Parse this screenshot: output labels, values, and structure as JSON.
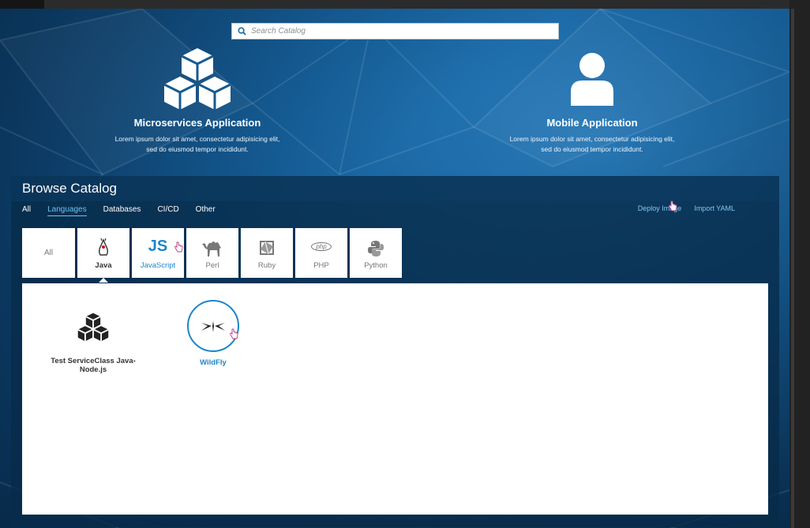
{
  "search": {
    "placeholder": "Search Catalog"
  },
  "featured": [
    {
      "title": "Microservices Application",
      "desc_line1": "Lorem ipsum dolor sit amet, consectetur adipisicing elit,",
      "desc_line2": "sed do eiusmod tempor incididunt.",
      "icon": "cubes-icon"
    },
    {
      "title": "Mobile Application",
      "desc_line1": "Lorem ipsum dolor sit amet, consectetur adipisicing elit,",
      "desc_line2": "sed do eiusmod tempor incididunt.",
      "icon": "user-icon"
    }
  ],
  "browse": {
    "title": "Browse Catalog",
    "tabs": [
      "All",
      "Languages",
      "Databases",
      "CI/CD",
      "Other"
    ],
    "active_tab": "Languages",
    "actions": [
      "Deploy Image",
      "Import YAML"
    ]
  },
  "languages": [
    {
      "label": "All",
      "icon": ""
    },
    {
      "label": "Java",
      "icon": "java-duke-icon",
      "selected": true
    },
    {
      "label": "JavaScript",
      "icon": "js-icon",
      "glyph": "JS"
    },
    {
      "label": "Perl",
      "icon": "camel-icon"
    },
    {
      "label": "Ruby",
      "icon": "ruby-icon"
    },
    {
      "label": "PHP",
      "icon": "php-icon",
      "glyph": "php"
    },
    {
      "label": "Python",
      "icon": "python-icon"
    }
  ],
  "items": [
    {
      "title": "Test ServiceClass Java-Node.js",
      "icon": "cubes-icon"
    },
    {
      "title": "WildFly",
      "icon": "wildfly-icon"
    }
  ],
  "colors": {
    "accent": "#1f86c8",
    "link": "#7ec7f0",
    "panel": "#072c4a"
  }
}
